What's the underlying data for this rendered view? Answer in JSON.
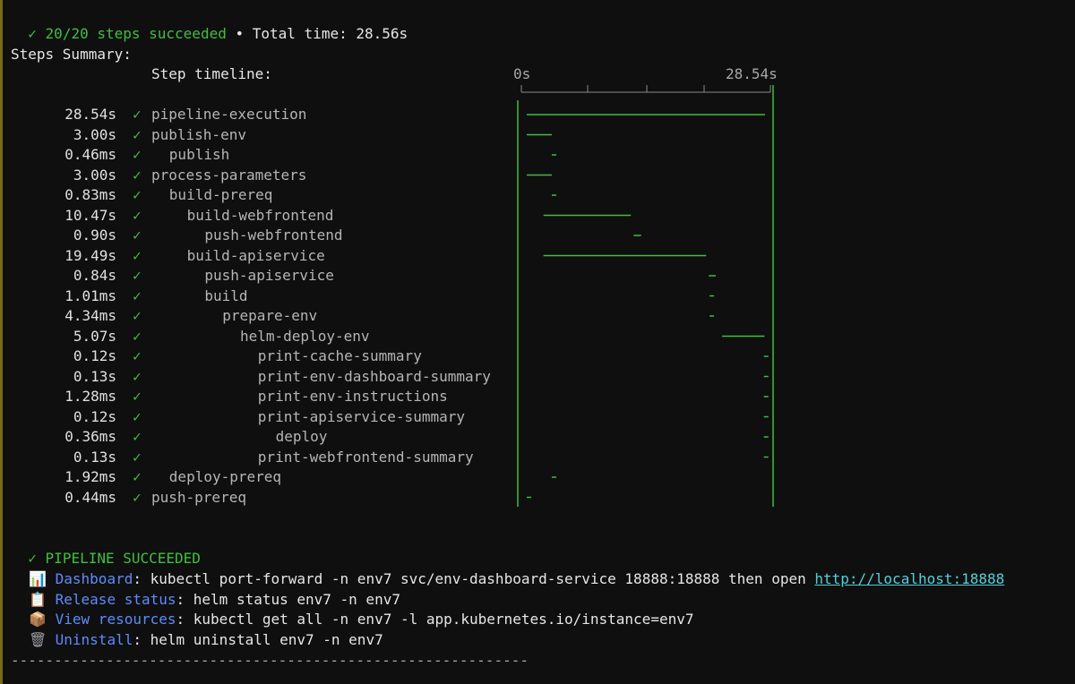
{
  "header": {
    "status_check": "✓",
    "status_text": "20/20 steps succeeded",
    "separator": " • ",
    "total_time_label": "Total time: 28.56s"
  },
  "summary": {
    "title": "Steps Summary:",
    "timeline_label": "Step timeline:",
    "axis_start": "0s",
    "axis_end": "28.54s"
  },
  "timeline_total_seconds": 28.54,
  "steps": [
    {
      "duration": "28.54s",
      "name": "pipeline-execution",
      "indent": 0,
      "start_s": 0.0,
      "length_s": 28.54
    },
    {
      "duration": "3.00s",
      "name": "publish-env",
      "indent": 0,
      "start_s": 0.0,
      "length_s": 3.0
    },
    {
      "duration": "0.46ms",
      "name": "publish",
      "indent": 1,
      "start_s": 3.0,
      "length_s": 0.0
    },
    {
      "duration": "3.00s",
      "name": "process-parameters",
      "indent": 0,
      "start_s": 0.0,
      "length_s": 3.0
    },
    {
      "duration": "0.83ms",
      "name": "build-prereq",
      "indent": 1,
      "start_s": 3.0,
      "length_s": 0.0
    },
    {
      "duration": "10.47s",
      "name": "build-webfrontend",
      "indent": 2,
      "start_s": 2.0,
      "length_s": 10.47
    },
    {
      "duration": "0.90s",
      "name": "push-webfrontend",
      "indent": 3,
      "start_s": 12.8,
      "length_s": 0.9
    },
    {
      "duration": "19.49s",
      "name": "build-apiservice",
      "indent": 2,
      "start_s": 2.0,
      "length_s": 19.49
    },
    {
      "duration": "0.84s",
      "name": "push-apiservice",
      "indent": 3,
      "start_s": 21.8,
      "length_s": 0.84
    },
    {
      "duration": "1.01ms",
      "name": "build",
      "indent": 3,
      "start_s": 21.9,
      "length_s": 0.0
    },
    {
      "duration": "4.34ms",
      "name": "prepare-env",
      "indent": 4,
      "start_s": 21.9,
      "length_s": 0.0
    },
    {
      "duration": "5.07s",
      "name": "helm-deploy-env",
      "indent": 5,
      "start_s": 23.4,
      "length_s": 5.07
    },
    {
      "duration": "0.12s",
      "name": "print-cache-summary",
      "indent": 6,
      "start_s": 28.4,
      "length_s": 0.12
    },
    {
      "duration": "0.13s",
      "name": "print-env-dashboard-summary",
      "indent": 6,
      "start_s": 28.4,
      "length_s": 0.13
    },
    {
      "duration": "1.28ms",
      "name": "print-env-instructions",
      "indent": 6,
      "start_s": 28.4,
      "length_s": 0.0
    },
    {
      "duration": "0.12s",
      "name": "print-apiservice-summary",
      "indent": 6,
      "start_s": 28.4,
      "length_s": 0.12
    },
    {
      "duration": "0.36ms",
      "name": "deploy",
      "indent": 7,
      "start_s": 28.4,
      "length_s": 0.0
    },
    {
      "duration": "0.13s",
      "name": "print-webfrontend-summary",
      "indent": 6,
      "start_s": 28.4,
      "length_s": 0.13
    },
    {
      "duration": "1.92ms",
      "name": "deploy-prereq",
      "indent": 1,
      "start_s": 3.0,
      "length_s": 0.0
    },
    {
      "duration": "0.44ms",
      "name": "push-prereq",
      "indent": 0,
      "start_s": 0.0,
      "length_s": 0.0
    }
  ],
  "result": {
    "check": "✓",
    "text": "PIPELINE SUCCEEDED"
  },
  "links": [
    {
      "icon": "📊",
      "icon_name": "bar-chart-icon",
      "label": "Dashboard",
      "colon": ":",
      "command": " kubectl port-forward -n env7 svc/env-dashboard-service 18888:18888",
      "suffix": " then open ",
      "url": "http://localhost:18888"
    },
    {
      "icon": "📋",
      "icon_name": "clipboard-icon",
      "label": "Release status",
      "colon": ":",
      "command": " helm status env7 -n env7",
      "suffix": "",
      "url": ""
    },
    {
      "icon": "📦",
      "icon_name": "package-icon",
      "label": "View resources",
      "colon": ":",
      "command": " kubectl get all -n env7 -l app.kubernetes.io/instance=env7",
      "suffix": "",
      "url": ""
    },
    {
      "icon": "🗑",
      "icon_name": "trash-icon",
      "label": "Uninstall",
      "colon": ":",
      "command": " helm uninstall env7 -n env7",
      "suffix": "",
      "url": ""
    }
  ],
  "footer_rule": "------------------------------------------------------------",
  "colors": {
    "success": "#3fbf3f",
    "link_label": "#5b8cff",
    "url": "#4fd1d9",
    "background": "#0f0f0f"
  }
}
